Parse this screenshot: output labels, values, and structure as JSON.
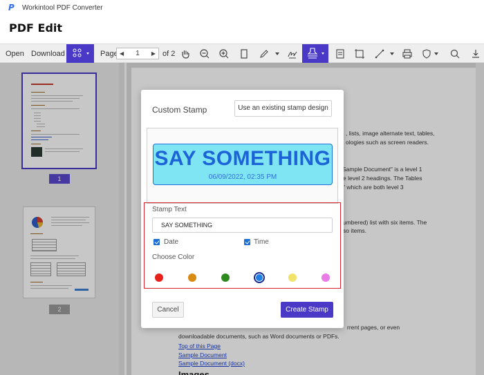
{
  "app": {
    "title": "Workintool PDF Converter",
    "page_title": "PDF Edit"
  },
  "toolbar": {
    "open_label": "Open",
    "download_label": "Download",
    "page_label": "Page",
    "page_current": "1",
    "page_total": "of 2"
  },
  "thumbnails": [
    {
      "number": "1",
      "selected": true
    },
    {
      "number": "2",
      "selected": false
    }
  ],
  "document": {
    "lines": [
      ", lists, image alternate text, tables,",
      "ologies such as screen readers.",
      "Sample Document\" is a level 1",
      "e level 2 headings. The Tables",
      "\" which are both level 3",
      "umbered) list with six items. The",
      "so items.",
      "rrent pages, or even",
      "downloadable documents, such as Word documents or PDFs."
    ],
    "links": [
      "Top of this Page",
      "Sample Document",
      "Sample Document (docx)"
    ],
    "heading_partial": "Images"
  },
  "modal": {
    "title": "Custom Stamp",
    "existing_button": "Use an existing stamp design",
    "preview": {
      "stamp_text": "SAY SOMETHING",
      "stamp_date": "06/09/2022, 02:35 PM"
    },
    "stamp_text_label": "Stamp Text",
    "stamp_text_value": "SAY SOMETHING",
    "date_label": "Date",
    "time_label": "Time",
    "date_checked": true,
    "time_checked": true,
    "choose_color_label": "Choose Color",
    "colors": [
      "#e8201a",
      "#d98a10",
      "#2e8a1e",
      "#1e7fe6",
      "#f0e26a",
      "#ea7be6"
    ],
    "selected_color_index": 3,
    "cancel_label": "Cancel",
    "create_label": "Create Stamp"
  },
  "colors": {
    "accent": "#4a39c7",
    "stamp_fill": "#7fe5f2",
    "stamp_text": "#1d63d8",
    "highlight_border": "#d9202a"
  }
}
